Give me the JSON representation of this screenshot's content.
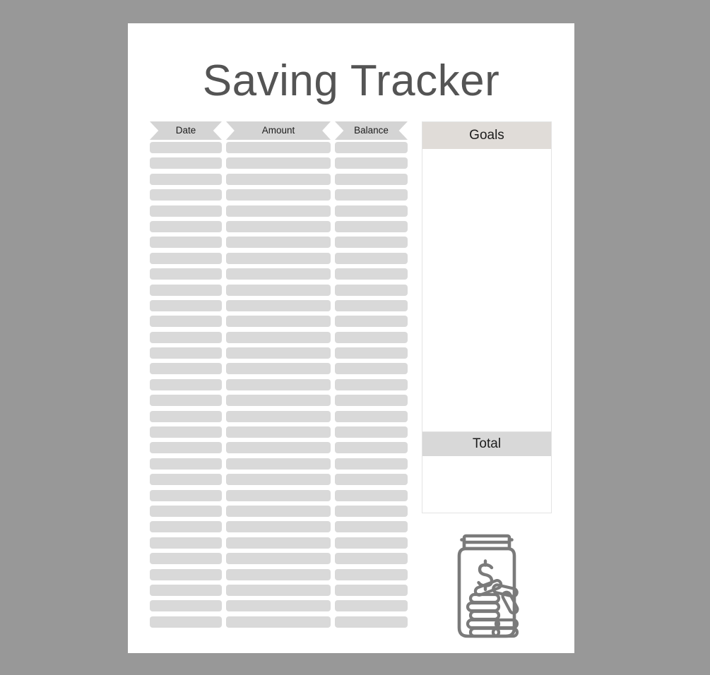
{
  "page": {
    "title": "Saving Tracker",
    "background_color": "#989898",
    "sheet_color": "#ffffff",
    "title_color": "#545454"
  },
  "table": {
    "columns": [
      {
        "key": "date",
        "label": "Date"
      },
      {
        "key": "amount",
        "label": "Amount"
      },
      {
        "key": "balance",
        "label": "Balance"
      }
    ],
    "row_count": 31,
    "rows_empty": true,
    "header_color": "#d4d4d4",
    "row_color": "#d9d9d9"
  },
  "goals": {
    "header_label": "Goals",
    "header_color": "#e0dcd8",
    "body_text": "",
    "border_color": "#e3e3e3"
  },
  "total": {
    "header_label": "Total",
    "header_color": "#d8d8d8",
    "body_text": "",
    "border_color": "#e3e3e3"
  },
  "decoration": {
    "jar_icon_name": "money-jar-icon",
    "jar_currency_symbol": "$",
    "jar_stroke_color": "#7a7a7a"
  }
}
